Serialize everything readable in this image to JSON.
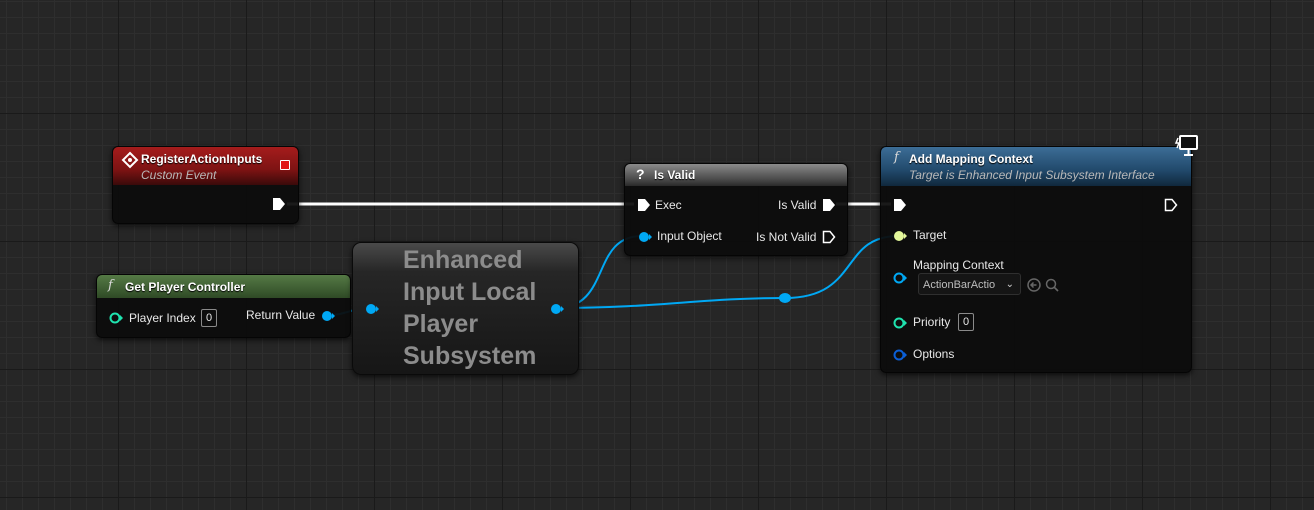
{
  "colors": {
    "exec": "#ffffff",
    "object_pin": "#00a8f4",
    "int_pin": "#1fe3af",
    "target_pin": "#e3f79a",
    "options_pin": "#0b4ec7",
    "event_header": "#8a1414",
    "pure_header": "#3c5a32",
    "func_header": "#1f4a6d",
    "macro_header": "#5a5a5a"
  },
  "nodes": {
    "register": {
      "icon": "event-diamond-icon",
      "title": "RegisterActionInputs",
      "subtitle": "Custom Event"
    },
    "get_pc": {
      "icon": "function-icon",
      "title": "Get Player Controller",
      "player_index_label": "Player Index",
      "player_index_value": "0",
      "return_label": "Return Value"
    },
    "enhanced": {
      "lines": [
        "Enhanced",
        "Input Local",
        "Player",
        "Subsystem"
      ]
    },
    "is_valid": {
      "icon": "question-icon",
      "title": "Is Valid",
      "exec_label": "Exec",
      "input_label": "Input Object",
      "valid_label": "Is Valid",
      "not_valid_label": "Is Not Valid"
    },
    "add_mapping": {
      "icon": "function-icon",
      "title": "Add Mapping Context",
      "subtitle": "Target is Enhanced Input Subsystem Interface",
      "target_label": "Target",
      "mapping_label": "Mapping Context",
      "mapping_value": "ActionBarActio",
      "priority_label": "Priority",
      "priority_value": "0",
      "options_label": "Options"
    }
  }
}
